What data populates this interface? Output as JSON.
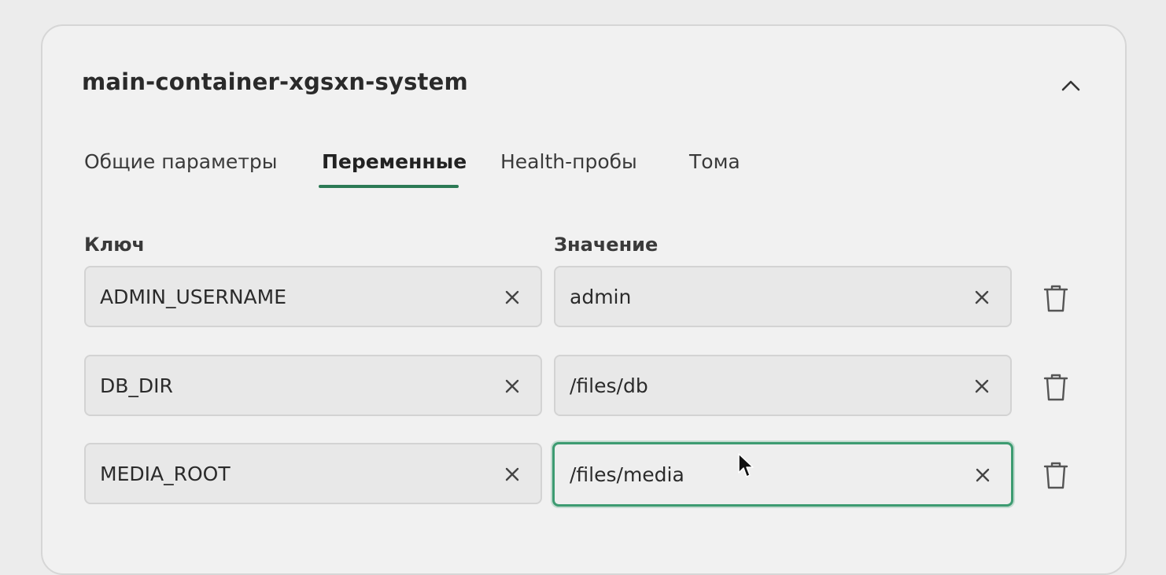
{
  "container": {
    "title": "main-container-xgsxn-system"
  },
  "tabs": [
    {
      "label": "Общие параметры",
      "active": false
    },
    {
      "label": "Переменные",
      "active": true
    },
    {
      "label": "Health-пробы",
      "active": false
    },
    {
      "label": "Тома",
      "active": false
    }
  ],
  "columns": {
    "key_label": "Ключ",
    "value_label": "Значение"
  },
  "variables": [
    {
      "key": "ADMIN_USERNAME",
      "value": "admin"
    },
    {
      "key": "DB_DIR",
      "value": "/files/db"
    },
    {
      "key": "MEDIA_ROOT",
      "value": "/files/media",
      "focused": true
    }
  ],
  "icons": {
    "collapse": "chevron-up-icon",
    "clear": "close-icon",
    "delete": "trash-icon"
  },
  "colors": {
    "accent": "#2c7a55",
    "focus_border": "#3d9b71"
  }
}
